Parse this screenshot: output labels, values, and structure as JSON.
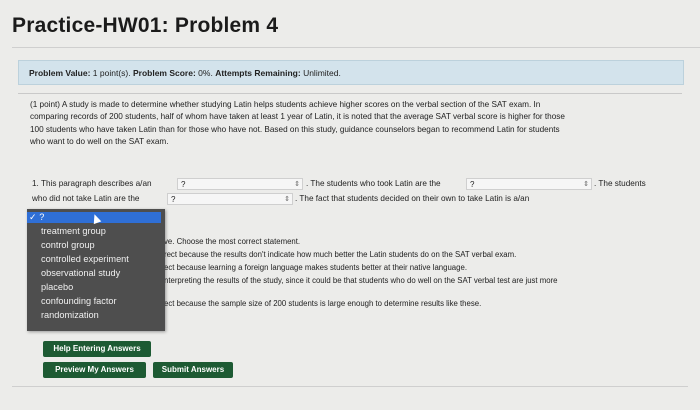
{
  "page": {
    "title": "Practice-HW01: Problem 4"
  },
  "info_bar": {
    "value_label": "Problem Value:",
    "value": "1 point(s).",
    "score_label": "Problem Score:",
    "score": "0%.",
    "attempts_label": "Attempts Remaining:",
    "attempts": "Unlimited."
  },
  "problem": {
    "lines": [
      "(1 point) A study is made to determine whether studying Latin helps students achieve higher scores on the verbal section of the SAT exam. In",
      "comparing records of 200 students, half of whom have taken at least 1 year of Latin, it is noted that the average SAT verbal score is higher for those",
      "100 students who have taken Latin than for those who have not. Based on this study, guidance counselors began to recommend Latin for students",
      "who want to do well on the SAT exam."
    ]
  },
  "question": {
    "q1_prefix": "1. This paragraph describes a/an",
    "select1_value": "?",
    "q1_middle": ". The students who took Latin are the",
    "select2_value": "?",
    "q1_suffix": ". The students",
    "q2_prefix": "who did not take Latin are the",
    "select3_value": "?",
    "q2_suffix": ". The fact that students decided on their own to take Latin is a/an"
  },
  "dropdown": {
    "options": [
      "✓ ?",
      "treatment group",
      "control group",
      "controlled experiment",
      "observational study",
      "placebo",
      "confounding factor",
      "randomization"
    ]
  },
  "statements": [
    "ve. Choose the most correct statement.",
    "rect because the results don't indicate how much better the Latin students do on the SAT verbal exam.",
    "ect because learning a foreign language makes students better at their native language.",
    "nterpreting the results of the study, since it could be that students who do well on the SAT verbal test are just more",
    "ect because the sample size of 200 students is large enough to determine results like these."
  ],
  "buttons": {
    "help": "Help Entering Answers",
    "preview": "Preview My Answers",
    "submit": "Submit Answers"
  },
  "colors": {
    "info_bar_bg": "#d3e3ec",
    "button_green": "#1d5a33",
    "dropdown_bg": "#4e4e4e",
    "dropdown_highlight": "#2f6fd6"
  }
}
